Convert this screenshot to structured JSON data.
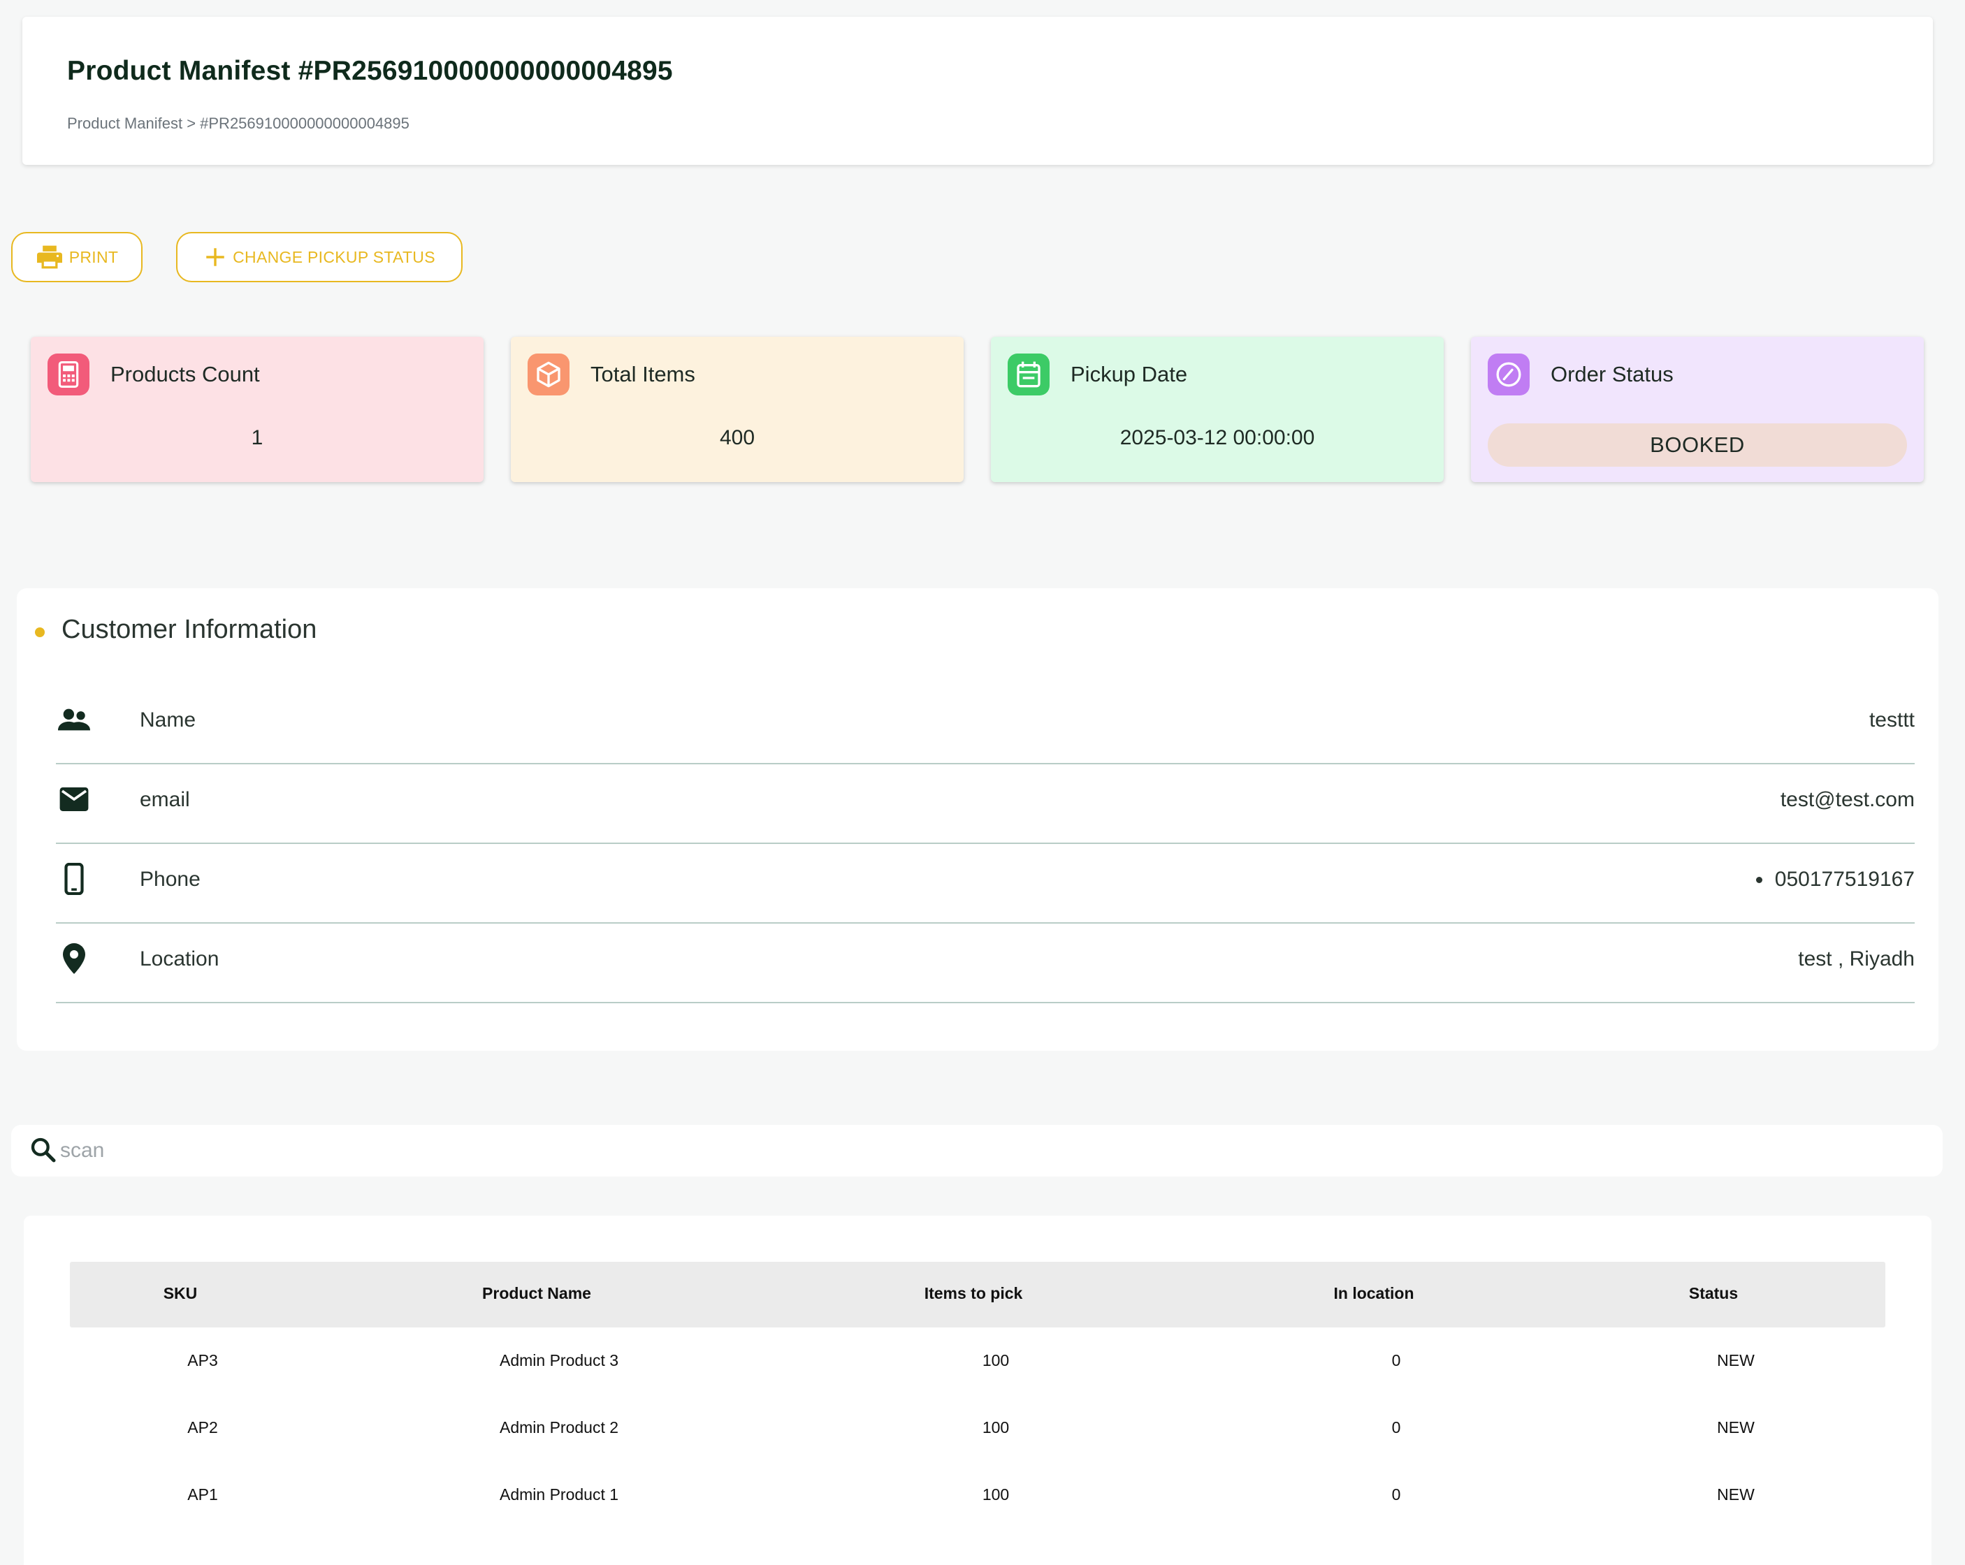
{
  "header": {
    "title": "Product Manifest #PR256910000000000004895",
    "breadcrumb": "Product Manifest > #PR256910000000000004895"
  },
  "actions": {
    "print_label": "PRINT",
    "change_status_label": "CHANGE PICKUP STATUS"
  },
  "stats": [
    {
      "label": "Products Count",
      "value": "1",
      "icon": "calculator-icon",
      "bg": "#fde1e5",
      "icon_bg": "#f25b7a"
    },
    {
      "label": "Total Items",
      "value": "400",
      "icon": "cube-icon",
      "bg": "#fdf2de",
      "icon_bg": "#f9966f"
    },
    {
      "label": "Pickup Date",
      "value": "2025-03-12 00:00:00",
      "icon": "calendar-icon",
      "bg": "#dcfae7",
      "icon_bg": "#3ccb66"
    },
    {
      "label": "Order Status",
      "value": "BOOKED",
      "icon": "compass-icon",
      "bg": "#f1e5fd",
      "icon_bg": "#c07df3"
    }
  ],
  "customer": {
    "title": "Customer Information",
    "rows": [
      {
        "label": "Name",
        "value": "testtt",
        "icon": "people-icon"
      },
      {
        "label": "email",
        "value": "test@test.com",
        "icon": "mail-icon"
      },
      {
        "label": "Phone",
        "value": "050177519167",
        "icon": "phone-icon"
      },
      {
        "label": "Location",
        "value": "test , Riyadh",
        "icon": "location-pin-icon"
      }
    ]
  },
  "search": {
    "placeholder": "scan"
  },
  "table": {
    "columns": [
      "SKU",
      "Product Name",
      "Items to pick",
      "In location",
      "Status"
    ],
    "rows": [
      [
        "AP3",
        "Admin Product 3",
        "100",
        "0",
        "NEW"
      ],
      [
        "AP2",
        "Admin Product 2",
        "100",
        "0",
        "NEW"
      ],
      [
        "AP1",
        "Admin Product 1",
        "100",
        "0",
        "NEW"
      ]
    ]
  },
  "colors": {
    "accent": "#e8b820",
    "divider": "#b9cdc7"
  }
}
